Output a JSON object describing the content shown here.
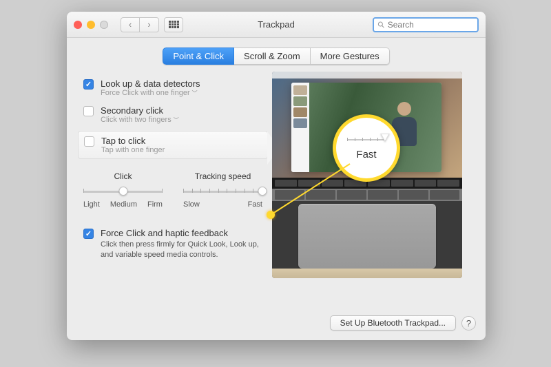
{
  "window": {
    "title": "Trackpad",
    "search_placeholder": "Search"
  },
  "tabs": [
    {
      "label": "Point & Click",
      "active": true
    },
    {
      "label": "Scroll & Zoom",
      "active": false
    },
    {
      "label": "More Gestures",
      "active": false
    }
  ],
  "options": {
    "lookup": {
      "title": "Look up & data detectors",
      "sub": "Force Click with one finger",
      "checked": true
    },
    "secondary": {
      "title": "Secondary click",
      "sub": "Click with two fingers",
      "checked": false
    },
    "tap": {
      "title": "Tap to click",
      "sub": "Tap with one finger",
      "checked": false
    }
  },
  "sliders": {
    "click": {
      "label": "Click",
      "ticks": [
        "Light",
        "Medium",
        "Firm"
      ],
      "position_pct": 50
    },
    "tracking": {
      "label": "Tracking speed",
      "ticks": [
        "Slow",
        "Fast"
      ],
      "position_pct": 100
    }
  },
  "force": {
    "title": "Force Click and haptic feedback",
    "desc": "Click then press firmly for Quick Look, Look up, and variable speed media controls.",
    "checked": true
  },
  "callout": {
    "label": "Fast"
  },
  "footer": {
    "bluetooth": "Set Up Bluetooth Trackpad...",
    "help": "?"
  }
}
